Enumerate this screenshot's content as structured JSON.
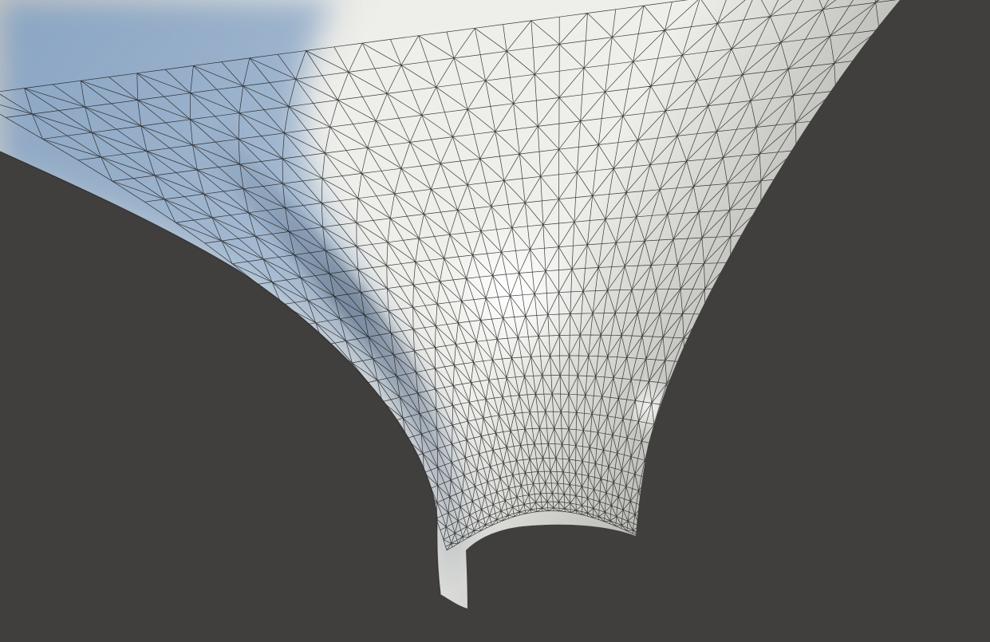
{
  "viewport": {
    "background_color": "#413f3d",
    "surface_light_color": "#eeeeea",
    "surface_mid_color": "#c7c7c2",
    "surface_dark_color": "#93938e",
    "sheen_blue_color": "#7f9fc4",
    "sheen_dark_blue_color": "#4c5f78",
    "specular_color": "#ffffff",
    "wire_color": "#1b1b1b"
  }
}
